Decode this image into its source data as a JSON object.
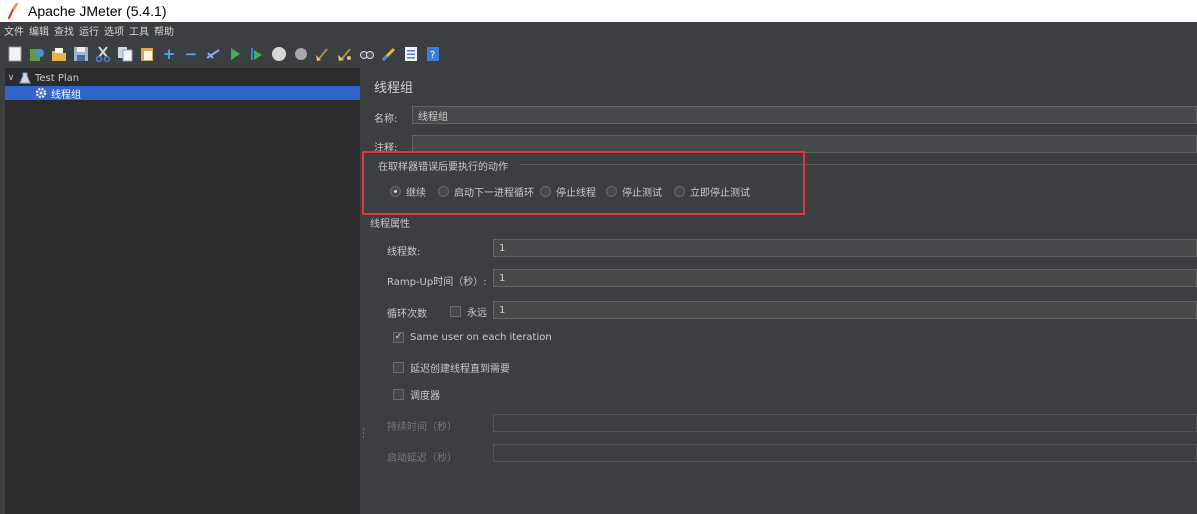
{
  "window": {
    "title": "Apache JMeter (5.4.1)"
  },
  "menu": [
    "文件",
    "编辑",
    "查找",
    "运行",
    "选项",
    "工具",
    "帮助"
  ],
  "toolbar_icons": [
    "new-icon",
    "templates-icon",
    "open-icon",
    "save-icon",
    "cut-icon",
    "copy-icon",
    "paste-icon",
    "expand-icon",
    "collapse-icon",
    "toggle-icon",
    "start-icon",
    "start-no-pause-icon",
    "stop-icon",
    "shutdown-icon",
    "clear-icon",
    "clear-all-icon",
    "search-icon",
    "reset-search-icon",
    "function-helper-icon",
    "help-icon"
  ],
  "tree": {
    "root": "Test Plan",
    "child": "线程组"
  },
  "panel": {
    "title": "线程组",
    "name_label": "名称:",
    "name_value": "线程组",
    "comment_label": "注释:",
    "comment_value": "",
    "error_group_title": "在取样器错误后要执行的动作",
    "error_actions": [
      {
        "label": "继续",
        "selected": true
      },
      {
        "label": "启动下一进程循环",
        "selected": false
      },
      {
        "label": "停止线程",
        "selected": false
      },
      {
        "label": "停止测试",
        "selected": false
      },
      {
        "label": "立即停止测试",
        "selected": false
      }
    ],
    "props_title": "线程属性",
    "threads_label": "线程数:",
    "threads_value": "1",
    "rampup_label": "Ramp-Up时间（秒）:",
    "rampup_value": "1",
    "loop_label": "循环次数",
    "forever_label": "永远",
    "forever_checked": false,
    "loop_value": "1",
    "same_user_label": "Same user on each iteration",
    "same_user_checked": true,
    "delay_label": "延迟创建线程直到需要",
    "delay_checked": false,
    "scheduler_label": "调度器",
    "scheduler_checked": false,
    "duration_label": "持续时间（秒）",
    "duration_value": "",
    "startup_delay_label": "启动延迟（秒）",
    "startup_delay_value": ""
  },
  "colors": {
    "highlight": "#e5333a",
    "selection": "#2f65ca",
    "panel_bg": "#3c3f41",
    "tree_bg": "#2b2b2b"
  }
}
